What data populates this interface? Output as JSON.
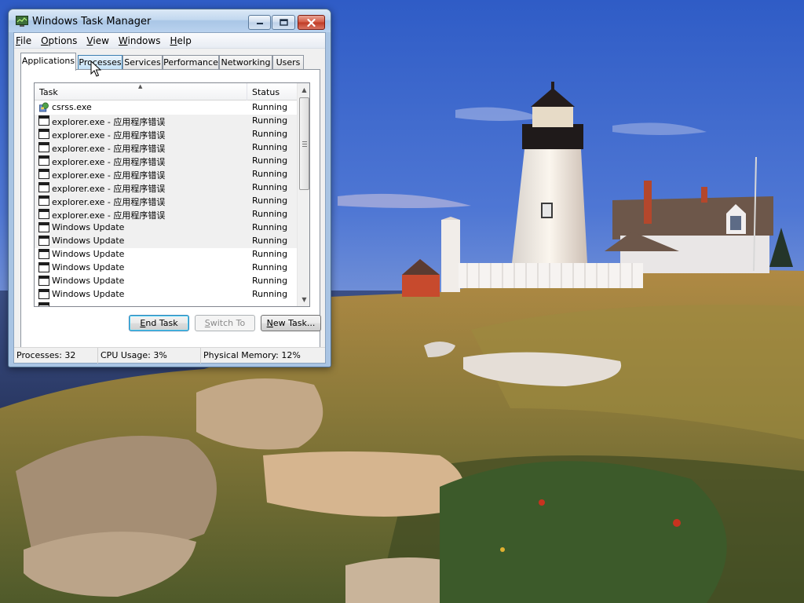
{
  "window": {
    "title": "Windows Task Manager"
  },
  "menu": [
    {
      "label": "File",
      "accel": "F",
      "rest": "ile"
    },
    {
      "label": "Options",
      "accel": "O",
      "rest": "ptions"
    },
    {
      "label": "View",
      "accel": "V",
      "rest": "iew"
    },
    {
      "label": "Windows",
      "accel": "W",
      "rest": "indows"
    },
    {
      "label": "Help",
      "accel": "H",
      "rest": "elp"
    }
  ],
  "tabs": [
    {
      "label": "Applications",
      "active": true
    },
    {
      "label": "Processes",
      "active": false,
      "hover": true
    },
    {
      "label": "Services",
      "active": false
    },
    {
      "label": "Performance",
      "active": false
    },
    {
      "label": "Networking",
      "active": false
    },
    {
      "label": "Users",
      "active": false
    }
  ],
  "list": {
    "columns": {
      "task": "Task",
      "status": "Status"
    },
    "rows": [
      {
        "task": "csrss.exe",
        "status": "Running",
        "icon": "globe-program-icon"
      },
      {
        "task": "explorer.exe - 应用程序错误",
        "status": "Running",
        "icon": "window-icon"
      },
      {
        "task": "explorer.exe - 应用程序错误",
        "status": "Running",
        "icon": "window-icon"
      },
      {
        "task": "explorer.exe - 应用程序错误",
        "status": "Running",
        "icon": "window-icon"
      },
      {
        "task": "explorer.exe - 应用程序错误",
        "status": "Running",
        "icon": "window-icon"
      },
      {
        "task": "explorer.exe - 应用程序错误",
        "status": "Running",
        "icon": "window-icon"
      },
      {
        "task": "explorer.exe - 应用程序错误",
        "status": "Running",
        "icon": "window-icon"
      },
      {
        "task": "explorer.exe - 应用程序错误",
        "status": "Running",
        "icon": "window-icon"
      },
      {
        "task": "explorer.exe - 应用程序错误",
        "status": "Running",
        "icon": "window-icon"
      },
      {
        "task": "Windows Update",
        "status": "Running",
        "icon": "window-icon"
      },
      {
        "task": "Windows Update",
        "status": "Running",
        "icon": "window-icon"
      },
      {
        "task": "Windows Update",
        "status": "Running",
        "icon": "window-icon"
      },
      {
        "task": "Windows Update",
        "status": "Running",
        "icon": "window-icon"
      },
      {
        "task": "Windows Update",
        "status": "Running",
        "icon": "window-icon"
      },
      {
        "task": "Windows Update",
        "status": "Running",
        "icon": "window-icon"
      },
      {
        "task": "",
        "status": "",
        "icon": "window-icon"
      }
    ]
  },
  "buttons": {
    "end_task": {
      "label": "End Task",
      "accel": "E",
      "rest": "nd Task"
    },
    "switch_to": {
      "label": "Switch To",
      "accel": "S",
      "rest": "witch To"
    },
    "new_task": {
      "label": "New Task...",
      "accel": "N",
      "rest": "ew Task..."
    }
  },
  "status": {
    "processes": "Processes: 32",
    "cpu": "CPU Usage: 3%",
    "memory": "Physical Memory: 12%"
  },
  "colors": {
    "selected_row_bg": "#f0f0f0",
    "window_frame": "#a9c4e3"
  }
}
